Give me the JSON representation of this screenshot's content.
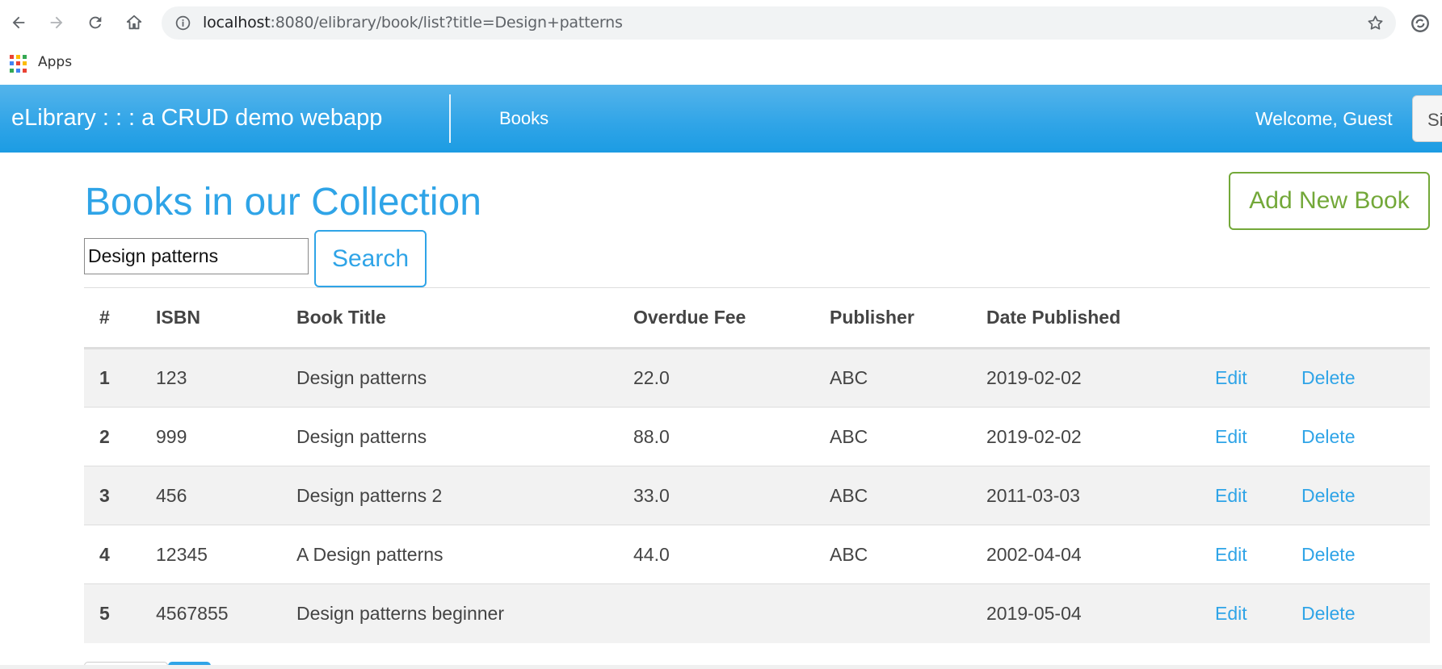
{
  "browser": {
    "url_host": "localhost",
    "url_rest": ":8080/elibrary/book/list?title=Design+patterns",
    "bookmarks": {
      "apps_label": "Apps"
    },
    "icons": [
      "back-icon",
      "forward-icon",
      "reload-icon",
      "home-icon",
      "info-icon",
      "star-icon",
      "extension-icon",
      "apps-icon"
    ]
  },
  "navbar": {
    "brand": "eLibrary : : : a CRUD demo webapp",
    "links": [
      "Books"
    ],
    "welcome": "Welcome, Guest",
    "signin_label": "Si",
    "colors": {
      "navbar_bg": "#2fa4e7",
      "text": "#ffffff"
    }
  },
  "main": {
    "title": "Books in our Collection",
    "add_button": "Add New Book",
    "search": {
      "value": "Design patterns",
      "button": "Search"
    },
    "table": {
      "headers": [
        "#",
        "ISBN",
        "Book Title",
        "Overdue Fee",
        "Publisher",
        "Date Published",
        "",
        ""
      ],
      "rows": [
        {
          "num": "1",
          "isbn": "123",
          "title": "Design patterns",
          "fee": "22.0",
          "publisher": "ABC",
          "date": "2019-02-02",
          "edit": "Edit",
          "delete": "Delete"
        },
        {
          "num": "2",
          "isbn": "999",
          "title": "Design patterns",
          "fee": "88.0",
          "publisher": "ABC",
          "date": "2019-02-02",
          "edit": "Edit",
          "delete": "Delete"
        },
        {
          "num": "3",
          "isbn": "456",
          "title": "Design patterns 2",
          "fee": "33.0",
          "publisher": "ABC",
          "date": "2011-03-03",
          "edit": "Edit",
          "delete": "Delete"
        },
        {
          "num": "4",
          "isbn": "12345",
          "title": "A Design patterns",
          "fee": "44.0",
          "publisher": "ABC",
          "date": "2002-04-04",
          "edit": "Edit",
          "delete": "Delete"
        },
        {
          "num": "5",
          "isbn": "4567855",
          "title": "Design patterns beginner",
          "fee": "",
          "publisher": "",
          "date": "2019-05-04",
          "edit": "Edit",
          "delete": "Delete"
        }
      ]
    },
    "colors": {
      "primary": "#2fa4e7",
      "success": "#73a839",
      "stripe": "#f2f2f2"
    }
  }
}
